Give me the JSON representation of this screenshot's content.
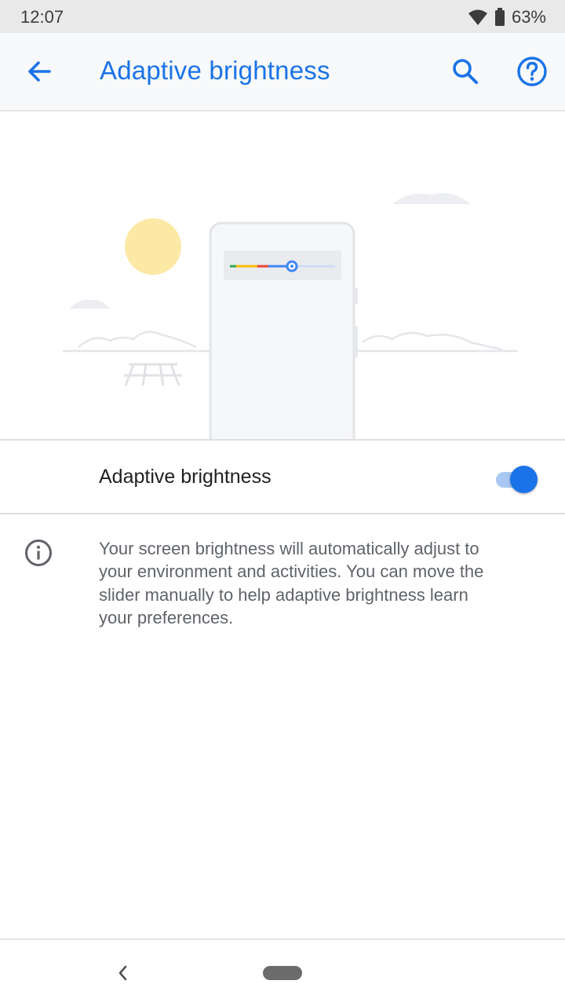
{
  "status_bar": {
    "time": "12:07",
    "battery": "63%",
    "icons": [
      "wifi-icon",
      "battery-icon"
    ]
  },
  "app_bar": {
    "title": "Adaptive brightness",
    "icons": [
      "back-arrow-icon",
      "search-icon",
      "help-icon"
    ]
  },
  "setting": {
    "label": "Adaptive brightness",
    "enabled": true
  },
  "info": {
    "lines": [
      "Your screen brightness will automatically adjust to",
      "your environment and activities. You can move the",
      "slider manually to help adaptive brightness learn",
      "your preferences."
    ]
  },
  "nav_bar": {
    "icons": [
      "nav-back-icon",
      "home-pill"
    ]
  },
  "colors": {
    "accent": "#1a73e8",
    "sun": "#fde9a6",
    "toggle_track": "#a8c7f3"
  }
}
